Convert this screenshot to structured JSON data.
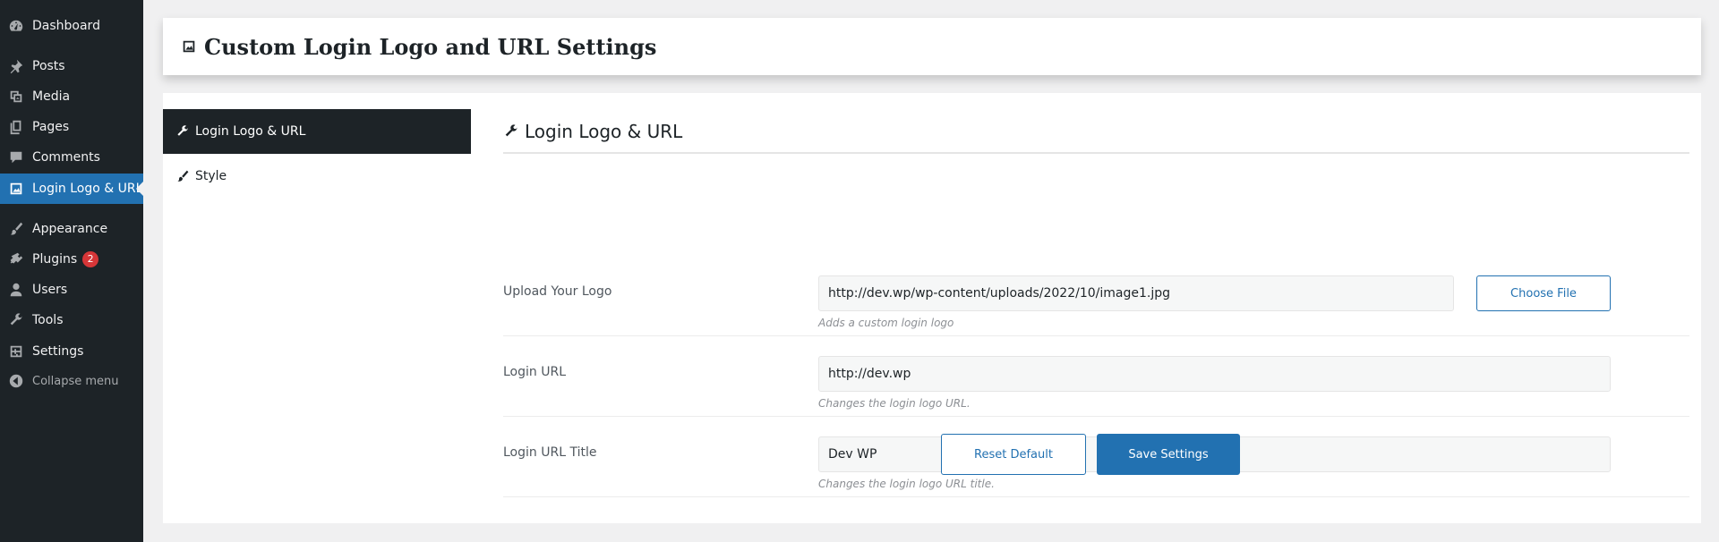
{
  "sidebar": {
    "items": [
      {
        "label": "Dashboard",
        "icon": "dashboard-icon"
      },
      {
        "label": "Posts",
        "icon": "pin-icon"
      },
      {
        "label": "Media",
        "icon": "media-icon"
      },
      {
        "label": "Pages",
        "icon": "pages-icon"
      },
      {
        "label": "Comments",
        "icon": "comment-icon"
      },
      {
        "label": "Login Logo & URL",
        "icon": "image-icon"
      },
      {
        "label": "Appearance",
        "icon": "brush-icon"
      },
      {
        "label": "Plugins",
        "icon": "plugin-icon",
        "badge": "2"
      },
      {
        "label": "Users",
        "icon": "user-icon"
      },
      {
        "label": "Tools",
        "icon": "wrench-icon"
      },
      {
        "label": "Settings",
        "icon": "settings-icon"
      },
      {
        "label": "Collapse menu",
        "icon": "collapse-icon"
      }
    ],
    "colors": {
      "background": "#1d2327",
      "current": "#2271b1"
    }
  },
  "header": {
    "title": "Custom Login Logo and URL Settings"
  },
  "tabs": [
    {
      "label": "Login Logo & URL",
      "icon": "wrench-icon"
    },
    {
      "label": "Style",
      "icon": "brush-icon"
    }
  ],
  "section": {
    "title": "Login Logo & URL"
  },
  "fields": {
    "logo": {
      "label": "Upload Your Logo",
      "value": "http://dev.wp/wp-content/uploads/2022/10/image1.jpg",
      "description": "Adds a custom login logo",
      "button": "Choose File"
    },
    "url": {
      "label": "Login URL",
      "value": "http://dev.wp",
      "description": "Changes the login logo URL."
    },
    "url_title": {
      "label": "Login URL Title",
      "value": "Dev WP",
      "description": "Changes the login logo URL title."
    }
  },
  "actions": {
    "reset": "Reset Default",
    "save": "Save Settings"
  },
  "colors": {
    "accent": "#2271b1",
    "badge": "#d63638"
  }
}
